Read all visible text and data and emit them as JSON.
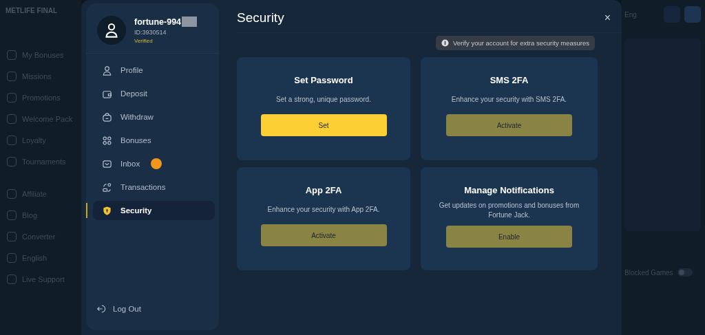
{
  "backdrop": {
    "brand": "METLIFE FINAL",
    "nav": [
      {
        "label": "My Bonuses"
      },
      {
        "label": "Missions"
      },
      {
        "label": "Promotions"
      },
      {
        "label": "Welcome Pack"
      },
      {
        "label": "Loyalty"
      },
      {
        "label": "Tournaments"
      },
      {
        "label": "Affiliate"
      },
      {
        "label": "Blog"
      },
      {
        "label": "Converter"
      },
      {
        "label": "English"
      },
      {
        "label": "Live Support"
      }
    ],
    "language": "Eng",
    "blocked_games": {
      "label": "Blocked Games",
      "on": false
    }
  },
  "account": {
    "username": "fortune-994",
    "id": "ID:3930514",
    "status": "Verified",
    "menu": [
      {
        "label": "Profile",
        "kind": "person",
        "selected": false,
        "badge": false
      },
      {
        "label": "Deposit",
        "kind": "wallet",
        "selected": false,
        "badge": false
      },
      {
        "label": "Withdraw",
        "kind": "bag",
        "selected": false,
        "badge": false
      },
      {
        "label": "Bonuses",
        "kind": "grid",
        "selected": false,
        "badge": false
      },
      {
        "label": "Inbox",
        "kind": "mail",
        "selected": false,
        "badge": true
      },
      {
        "label": "Transactions",
        "kind": "swap",
        "selected": false,
        "badge": false
      },
      {
        "label": "Security",
        "kind": "shield",
        "selected": true,
        "badge": false
      }
    ],
    "logout": "Log Out"
  },
  "security": {
    "title": "Security",
    "close": "×",
    "notice": "Verify your account for extra security measures",
    "cards": [
      {
        "title": "Set Password",
        "description": "Set a strong, unique password.",
        "button": "Set",
        "kind": "primary"
      },
      {
        "title": "SMS 2FA",
        "description": "Enhance your security with SMS 2FA.",
        "button": "Activate",
        "kind": "secondary"
      },
      {
        "title": "App 2FA",
        "description": "Enhance your security with App 2FA.",
        "button": "Activate",
        "kind": "secondary"
      },
      {
        "title": "Manage Notifications",
        "description": "Get updates on promotions and bonuses from Fortune Jack.",
        "button": "Enable",
        "kind": "secondary"
      }
    ]
  }
}
